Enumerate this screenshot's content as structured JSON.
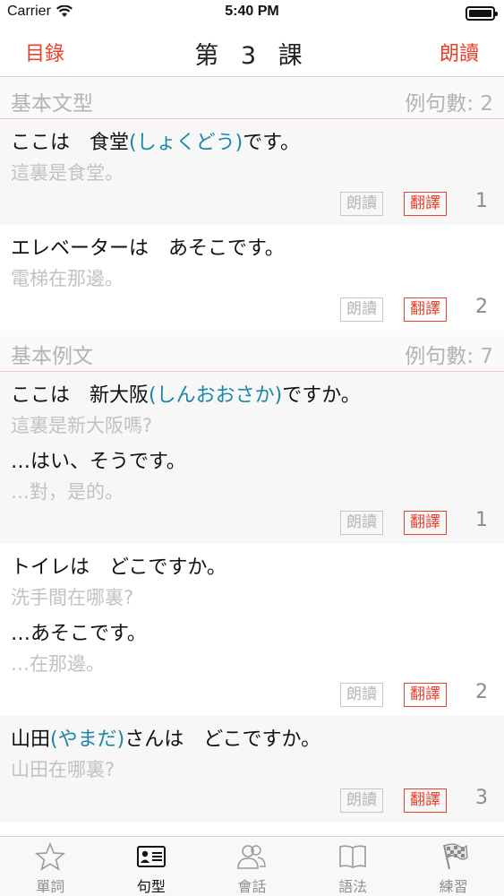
{
  "status_bar": {
    "carrier": "Carrier",
    "time": "5:40 PM"
  },
  "nav": {
    "left": "目錄",
    "title": "第 3 課",
    "right": "朗讀"
  },
  "sections": [
    {
      "title": "基本文型",
      "count": "例句數: 2",
      "items": [
        {
          "lines": [
            {
              "type": "jp",
              "parts": [
                {
                  "t": "ここは　食堂",
                  "f": false
                },
                {
                  "t": "(しょくどう)",
                  "f": true
                },
                {
                  "t": "です。",
                  "f": false
                }
              ]
            },
            {
              "type": "zh",
              "text": "這裏是食堂。"
            }
          ],
          "read": "朗讀",
          "trans": "翻譯",
          "num": "1"
        },
        {
          "lines": [
            {
              "type": "jp",
              "parts": [
                {
                  "t": "エレベーターは　あそこです。",
                  "f": false
                }
              ]
            },
            {
              "type": "zh",
              "text": "電梯在那邊。"
            }
          ],
          "read": "朗讀",
          "trans": "翻譯",
          "num": "2"
        }
      ]
    },
    {
      "title": "基本例文",
      "count": "例句數: 7",
      "items": [
        {
          "lines": [
            {
              "type": "jp",
              "parts": [
                {
                  "t": "ここは　新大阪",
                  "f": false
                },
                {
                  "t": "(しんおおさか)",
                  "f": true
                },
                {
                  "t": "ですか。",
                  "f": false
                }
              ]
            },
            {
              "type": "zh",
              "text": "這裏是新大阪嗎?"
            },
            {
              "type": "jp",
              "parts": [
                {
                  "t": "…はい、そうです。",
                  "f": false
                }
              ]
            },
            {
              "type": "zh",
              "text": "…對，是的。"
            }
          ],
          "read": "朗讀",
          "trans": "翻譯",
          "num": "1"
        },
        {
          "lines": [
            {
              "type": "jp",
              "parts": [
                {
                  "t": "トイレは　どこですか。",
                  "f": false
                }
              ]
            },
            {
              "type": "zh",
              "text": "洗手間在哪裏?"
            },
            {
              "type": "jp",
              "parts": [
                {
                  "t": "…あそこです。",
                  "f": false
                }
              ]
            },
            {
              "type": "zh",
              "text": "…在那邊。"
            }
          ],
          "read": "朗讀",
          "trans": "翻譯",
          "num": "2"
        },
        {
          "lines": [
            {
              "type": "jp",
              "parts": [
                {
                  "t": "山田",
                  "f": false
                },
                {
                  "t": "(やまだ)",
                  "f": true
                },
                {
                  "t": "さんは　どこですか。",
                  "f": false
                }
              ]
            },
            {
              "type": "zh",
              "text": "山田在哪裏?"
            }
          ],
          "read": "朗讀",
          "trans": "翻譯",
          "num": "3"
        }
      ]
    }
  ],
  "tabs": [
    {
      "label": "單詞",
      "icon": "star-icon",
      "active": false
    },
    {
      "label": "句型",
      "icon": "id-card-icon",
      "active": true
    },
    {
      "label": "會話",
      "icon": "people-icon",
      "active": false
    },
    {
      "label": "語法",
      "icon": "book-icon",
      "active": false
    },
    {
      "label": "練習",
      "icon": "checkered-flag-icon",
      "active": false
    }
  ],
  "colors": {
    "accent": "#e8412c",
    "furigana": "#1b87a8",
    "translation": "#c2c2c2",
    "section_text": "#b3b3b3"
  }
}
